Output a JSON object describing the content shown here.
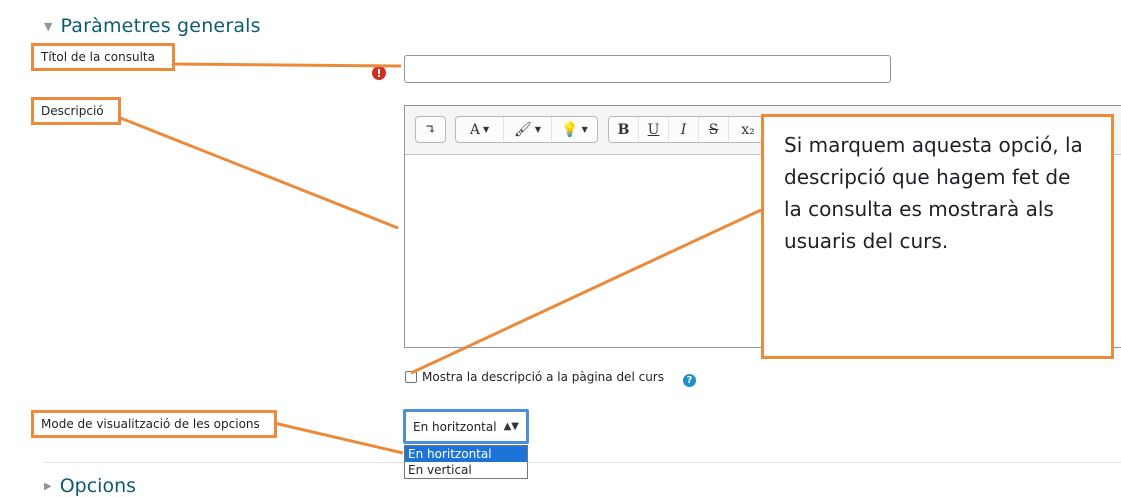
{
  "section_general": {
    "toggle_icon": "caret-down-icon",
    "title": "Paràmetres generals"
  },
  "fields": {
    "title_label": "Títol de la consulta",
    "title_value": "",
    "description_label": "Descripció",
    "show_description_label": "Mostra la descripció a la pàgina del curs",
    "display_mode_label": "Mode de visualització de les opcions"
  },
  "editor_toolbar": {
    "groups": [
      [
        "↴"
      ],
      [
        "A",
        "🖌",
        "💡"
      ],
      [
        "B",
        "U",
        "I",
        "S",
        "x₂"
      ]
    ]
  },
  "callout": {
    "text": "Si marquem aquesta opció, la descripció que hagem fet de la consulta es mostrarà als usuaris del curs."
  },
  "display_mode_select": {
    "selected": "En horitzontal",
    "options": [
      "En horitzontal",
      "En vertical"
    ]
  },
  "section_options": {
    "toggle_icon": "caret-right-icon",
    "title": "Opcions"
  },
  "colors": {
    "highlight": "#ec8a3c",
    "heading": "#0f5b6e",
    "select_focus": "#4a90d9",
    "option_selected": "#1e74d6",
    "error": "#ca3120",
    "help": "#1f8fc9"
  }
}
